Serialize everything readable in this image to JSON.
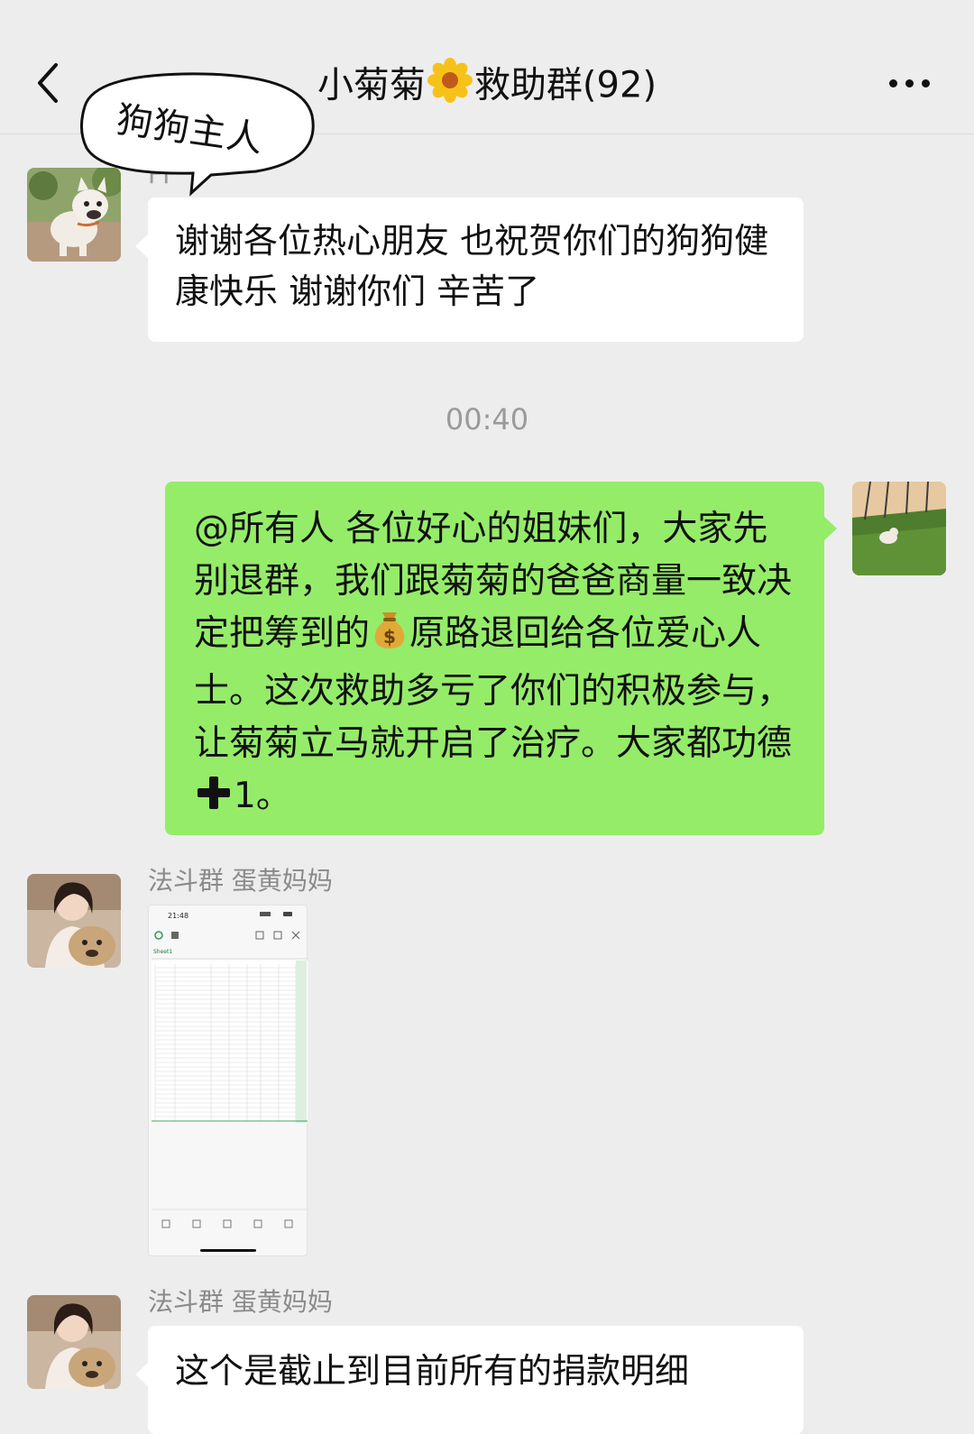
{
  "header": {
    "title_part1": "小菊菊",
    "title_part2": "救助群(92)",
    "flower_icon": "sunflower-icon"
  },
  "annotation": {
    "label": "狗狗主人"
  },
  "messages": [
    {
      "sender": "FF",
      "text": "谢谢各位热心朋友 也祝贺你们的狗狗健康快乐 谢谢你们 辛苦了"
    },
    {
      "timestamp": "00:40"
    },
    {
      "self": true,
      "text_part1": "@所有人 各位好心的姐妹们，大家先别退群，我们跟菊菊的爸爸商量一致决定把筹到的",
      "emoji_1": "money-bag-icon",
      "text_part2": "原路退回给各位爱心人士。这次救助多亏了你们的积极参与，让菊菊立马就开启了治疗。大家都功德",
      "emoji_2": "plus-icon",
      "text_part3": "1。"
    },
    {
      "sender": "法斗群 蛋黄妈妈",
      "image": "donation-spreadsheet-screenshot",
      "image_time": "21:48",
      "image_sheet_tab": "Sheet1"
    },
    {
      "sender": "法斗群 蛋黄妈妈",
      "text": "这个是截止到目前所有的捐款明细"
    }
  ],
  "colors": {
    "background": "#ededed",
    "self_bubble": "#95ec69",
    "other_bubble": "#ffffff",
    "meta_text": "#8a8a8a"
  }
}
